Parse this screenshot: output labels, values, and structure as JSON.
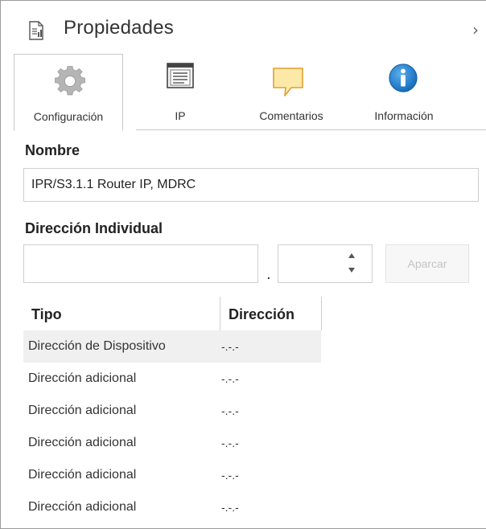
{
  "panel": {
    "title": "Propiedades",
    "collapse_glyph": "›"
  },
  "tabs": [
    {
      "label": "Configuración",
      "icon": "gear-icon",
      "active": true
    },
    {
      "label": "IP",
      "icon": "ip-window-icon",
      "active": false
    },
    {
      "label": "Comentarios",
      "icon": "comment-icon",
      "active": false
    },
    {
      "label": "Información",
      "icon": "info-icon",
      "active": false
    }
  ],
  "form": {
    "name_label": "Nombre",
    "name_value": "IPR/S3.1.1 Router IP, MDRC",
    "address_label": "Dirección Individual",
    "address_prefix_value": "",
    "address_suffix_value": "",
    "separator": ".",
    "assign_button": "Aparcar"
  },
  "table": {
    "columns": [
      "Tipo",
      "Dirección"
    ],
    "rows": [
      {
        "type": "Dirección de Dispositivo",
        "address": "-.-.-"
      },
      {
        "type": "Dirección adicional",
        "address": "-.-.-"
      },
      {
        "type": "Dirección adicional",
        "address": "-.-.-"
      },
      {
        "type": "Dirección adicional",
        "address": "-.-.-"
      },
      {
        "type": "Dirección adicional",
        "address": "-.-.-"
      },
      {
        "type": "Dirección adicional",
        "address": "-.-.-"
      }
    ]
  },
  "colors": {
    "info_blue": "#1e7fd1",
    "comment_yellow": "#fce9a8",
    "comment_border": "#e0a030",
    "gear_gray": "#b5b5b5"
  }
}
